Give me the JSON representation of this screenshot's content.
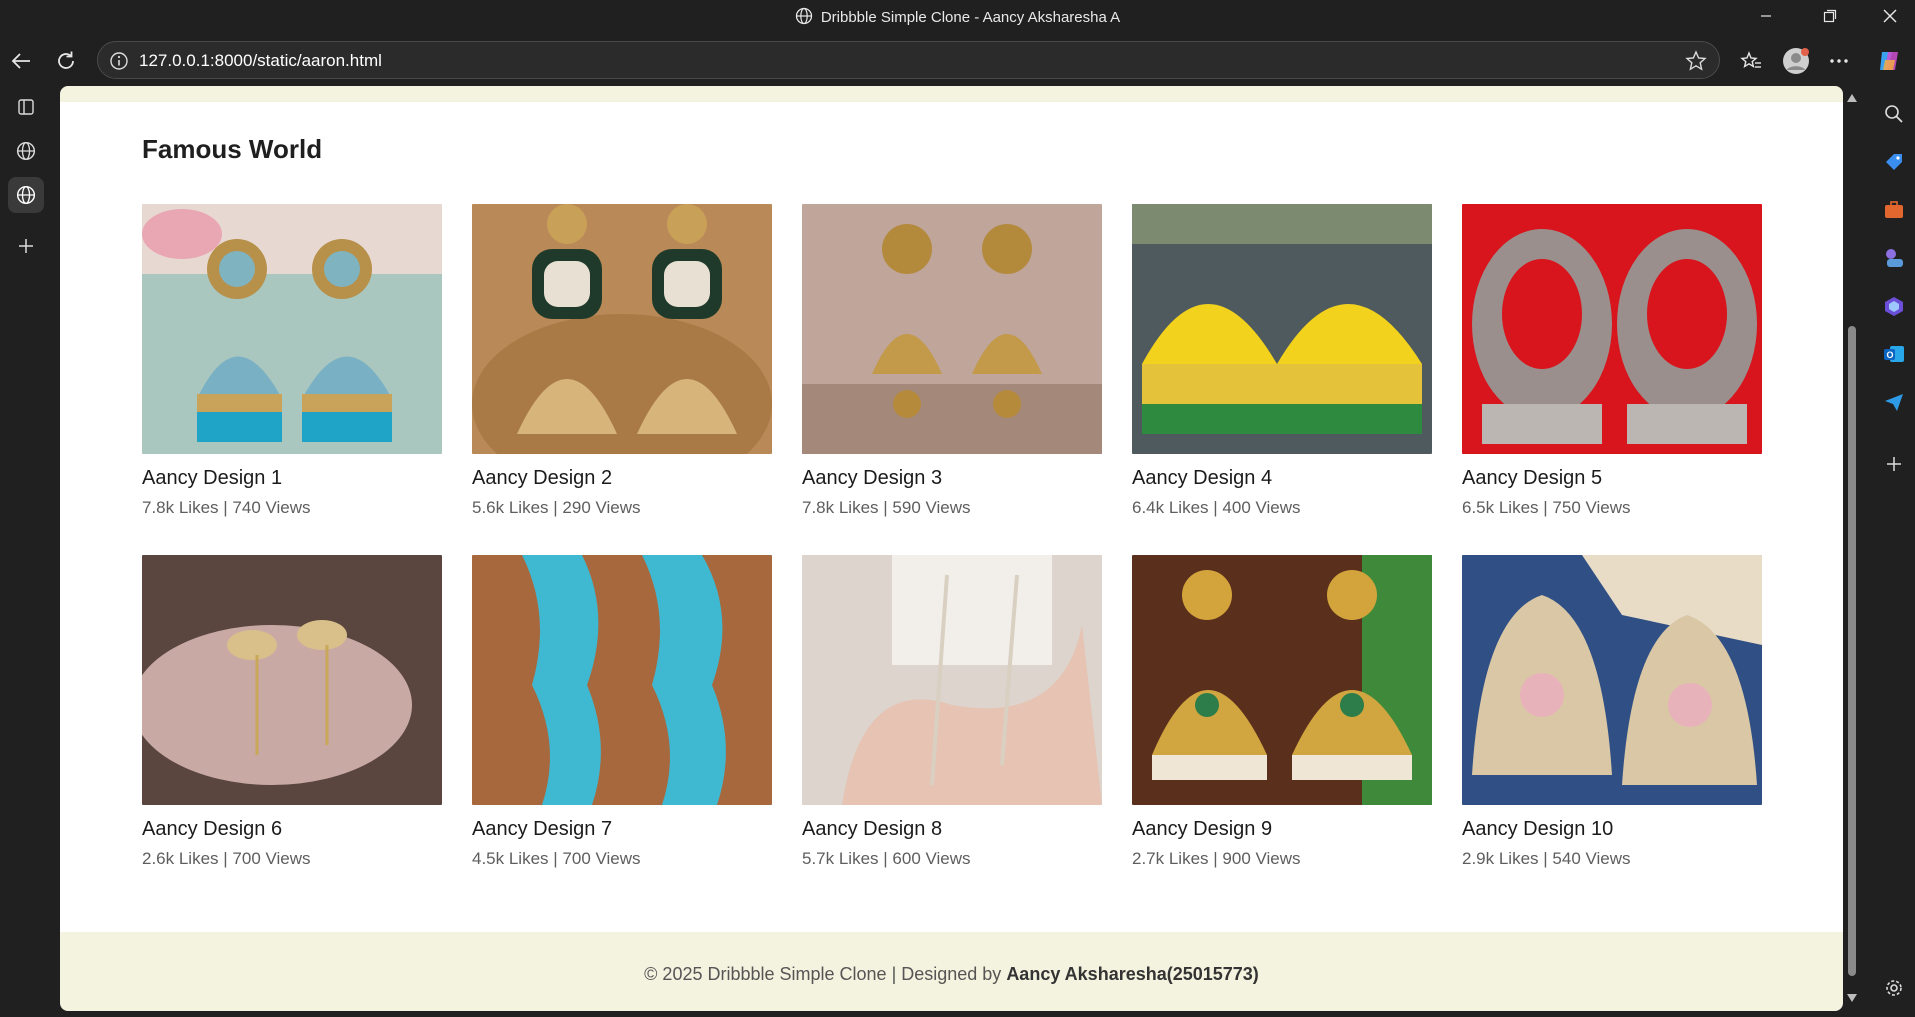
{
  "window": {
    "title": "Dribbble Simple Clone - Aancy Aksharesha A"
  },
  "browser": {
    "url": "127.0.0.1:8000/static/aaron.html"
  },
  "page": {
    "section_title": "Famous World",
    "designs": [
      {
        "name": "Aancy Design 1",
        "stats": "7.8k Likes | 740 Views",
        "image": "turquoise-jhumka-earrings"
      },
      {
        "name": "Aancy Design 2",
        "stats": "5.6k Likes | 290 Views",
        "image": "kundan-jhumka-earrings"
      },
      {
        "name": "Aancy Design 3",
        "stats": "7.8k Likes | 590 Views",
        "image": "gold-temple-earrings"
      },
      {
        "name": "Aancy Design 4",
        "stats": "6.4k Likes | 400 Views",
        "image": "yellow-enamel-jhumka"
      },
      {
        "name": "Aancy Design 5",
        "stats": "6.5k Likes | 750 Views",
        "image": "silver-chandbali-earrings"
      },
      {
        "name": "Aancy Design 6",
        "stats": "2.6k Likes | 700 Views",
        "image": "bow-drop-earrings"
      },
      {
        "name": "Aancy Design 7",
        "stats": "4.5k Likes | 700 Views",
        "image": "aqua-crystal-earrings"
      },
      {
        "name": "Aancy Design 8",
        "stats": "5.7k Likes | 600 Views",
        "image": "pearl-thread-earrings"
      },
      {
        "name": "Aancy Design 9",
        "stats": "2.7k Likes | 900 Views",
        "image": "peacock-gold-earrings"
      },
      {
        "name": "Aancy Design 10",
        "stats": "2.9k Likes | 540 Views",
        "image": "pink-kundan-earrings"
      }
    ],
    "footer": {
      "prefix": "© 2025 Dribbble Simple Clone | Designed by ",
      "author": "Aancy Aksharesha(25015773)"
    }
  },
  "colors": {
    "footer_bg": "#f4f3df",
    "page_bg": "#ffffff",
    "browser_chrome": "#202020"
  }
}
